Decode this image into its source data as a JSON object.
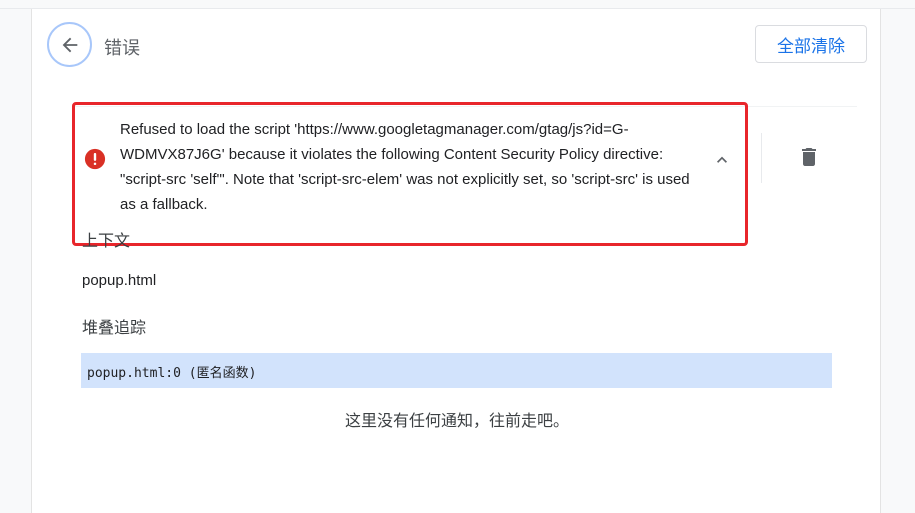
{
  "header": {
    "title": "错误",
    "clear_all_label": "全部清除"
  },
  "error": {
    "message": "Refused to load the script 'https://www.googletagmanager.com/gtag/js?id=G-WDMVX87J6G' because it violates the following Content Security Policy directive: \"script-src 'self'\". Note that 'script-src-elem' was not explicitly set, so 'script-src' is used as a fallback.",
    "icon": "error-icon",
    "severity_color": "#d93025",
    "highlight_color": "#e8262b"
  },
  "details": {
    "context_label": "上下文",
    "context_value": "popup.html",
    "stack_label": "堆叠追踪",
    "stack_frames": [
      "popup.html:0 (匿名函数)"
    ],
    "empty_message": "这里没有任何通知，往前走吧。"
  },
  "colors": {
    "accent": "#1a73e8",
    "stack_highlight": "#d2e3fc"
  }
}
